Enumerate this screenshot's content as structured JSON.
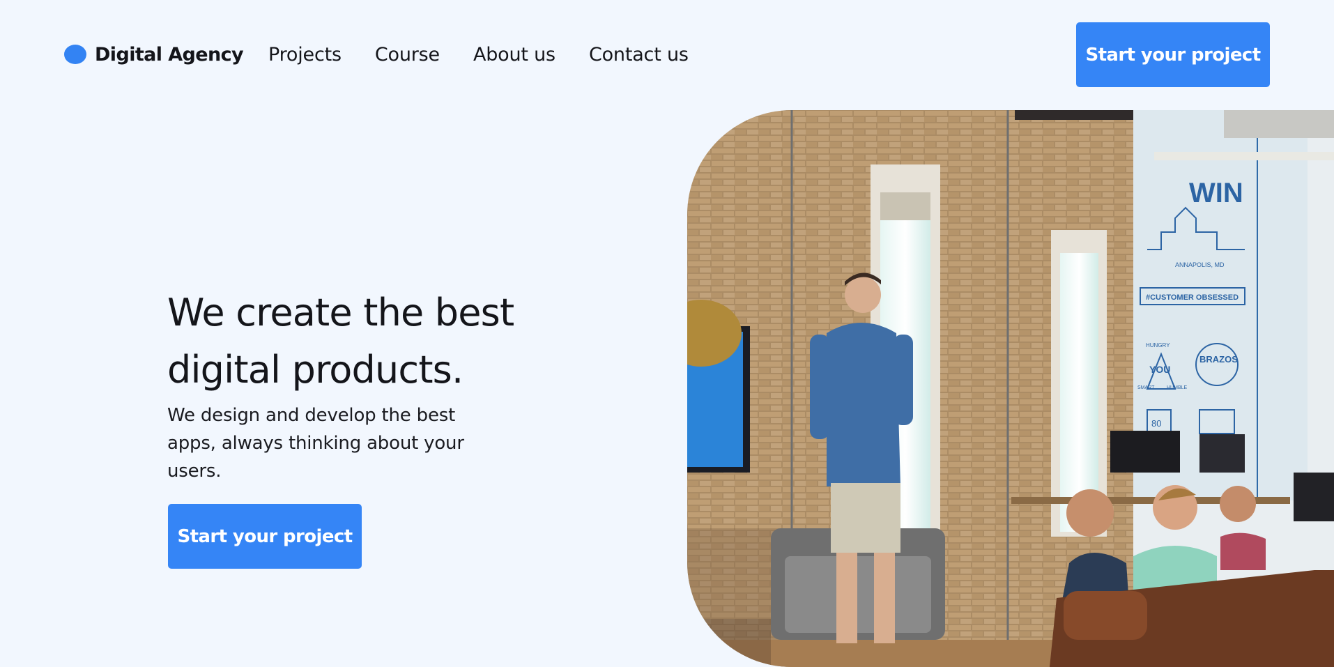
{
  "brand": {
    "name": "Digital Agency",
    "accent_color": "#3585f6"
  },
  "nav": {
    "links": [
      {
        "label": "Projects"
      },
      {
        "label": "Course"
      },
      {
        "label": "About us"
      },
      {
        "label": "Contact us"
      }
    ],
    "cta_label": "Start your project"
  },
  "hero": {
    "title": "We create the best digital products.",
    "subtitle": "We design and develop the best apps, always thinking about your users.",
    "cta_label": "Start your project"
  },
  "photo": {
    "wall_sign": "WIN",
    "banner_text": "#CUSTOMER OBSESSED",
    "city_caption": "ANNAPOLIS, MD",
    "badge_left": "YOU",
    "badge_left_top": "HUNGRY",
    "badge_left_bottom_1": "SMART",
    "badge_left_bottom_2": "HUMBLE",
    "badge_right": "BRAZOS",
    "mug_number": "80"
  }
}
